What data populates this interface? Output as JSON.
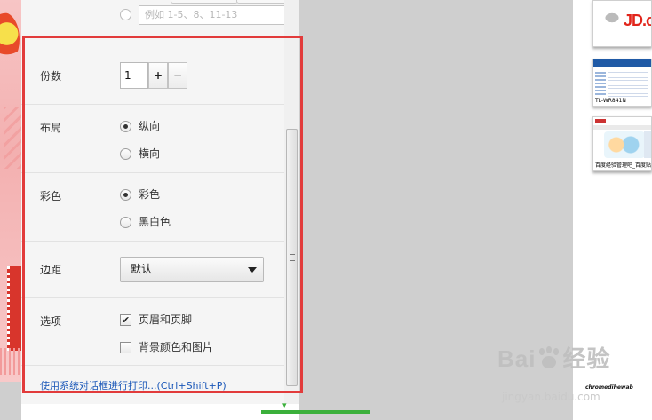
{
  "print_settings": {
    "pages_placeholder": "例如 1-5、8、11-13",
    "copies": {
      "label": "份数",
      "value": "1",
      "plus": "+",
      "minus": "−"
    },
    "layout": {
      "label": "布局",
      "options": [
        "纵向",
        "横向"
      ],
      "selected": "纵向"
    },
    "color": {
      "label": "彩色",
      "options": [
        "彩色",
        "黑白色"
      ],
      "selected": "彩色"
    },
    "margins": {
      "label": "边距",
      "value": "默认"
    },
    "options": {
      "label": "选项",
      "items": [
        {
          "label": "页眉和页脚",
          "checked": true
        },
        {
          "label": "背景颜色和图片",
          "checked": false
        }
      ]
    },
    "system_dialog_link": "使用系统对话框进行打印...(Ctrl+Shift+P)"
  },
  "preview": {
    "thumb1_logo": "JD.c",
    "thumb2_caption": "TL-WR841N",
    "thumb3_caption": "百度经验管理吧_百度贴",
    "footer_text": "chromedihewab"
  },
  "watermark": {
    "main": "Bai",
    "suffix": "经验",
    "sub": "jingyan.baidu.com"
  },
  "colors": {
    "highlight": "#e23b3b",
    "link": "#1a57b8",
    "panel_bg": "#f5f5f5",
    "preview_bg": "#cfcfcf"
  }
}
